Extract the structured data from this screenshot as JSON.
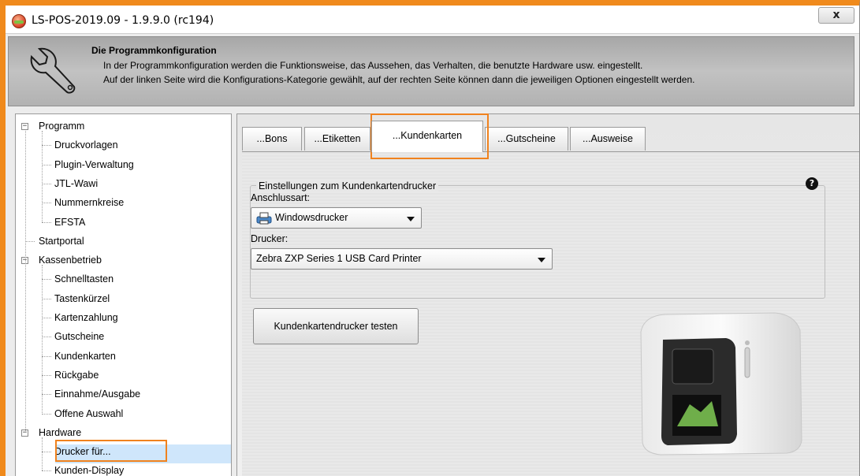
{
  "window": {
    "title": "LS-POS-2019.09 - 1.9.9.0 (rc194)",
    "close_label": "x",
    "accent_color": "#f0821e"
  },
  "header": {
    "title": "Die Programmkonfiguration",
    "line1": "In der Programmkonfiguration werden die Funktionsweise, das Aussehen, das Verhalten, die benutzte Hardware usw. eingestellt.",
    "line2": "Auf der linken Seite wird die Konfigurations-Kategorie gewählt, auf der rechten Seite können dann die jeweiligen Optionen eingestellt werden.",
    "icon": "wrench-icon"
  },
  "tree": {
    "items": [
      {
        "label": "Programm",
        "level": 0,
        "expanded": true
      },
      {
        "label": "Druckvorlagen",
        "level": 1
      },
      {
        "label": "Plugin-Verwaltung",
        "level": 1
      },
      {
        "label": "JTL-Wawi",
        "level": 1
      },
      {
        "label": "Nummernkreise",
        "level": 1
      },
      {
        "label": "EFSTA",
        "level": 1
      },
      {
        "label": "Startportal",
        "level": 0
      },
      {
        "label": "Kassenbetrieb",
        "level": 0,
        "expanded": true
      },
      {
        "label": "Schnelltasten",
        "level": 1
      },
      {
        "label": "Tastenkürzel",
        "level": 1
      },
      {
        "label": "Kartenzahlung",
        "level": 1
      },
      {
        "label": "Gutscheine",
        "level": 1
      },
      {
        "label": "Kundenkarten",
        "level": 1
      },
      {
        "label": "Rückgabe",
        "level": 1
      },
      {
        "label": "Einnahme/Ausgabe",
        "level": 1
      },
      {
        "label": "Offene Auswahl",
        "level": 1
      },
      {
        "label": "Hardware",
        "level": 0,
        "expanded": true
      },
      {
        "label": "Drucker für...",
        "level": 1,
        "selected": true
      },
      {
        "label": "Kunden-Display",
        "level": 1
      }
    ]
  },
  "tabs": [
    {
      "label": "...Bons",
      "active": false
    },
    {
      "label": "...Etiketten",
      "active": false
    },
    {
      "label": "...Kundenkarten",
      "active": true
    },
    {
      "label": "...Gutscheine",
      "active": false
    },
    {
      "label": "...Ausweise",
      "active": false
    }
  ],
  "settings": {
    "group_title": "Einstellungen zum Kundenkartendrucker",
    "help_icon": "?",
    "connection_label": "Anschlussart:",
    "connection_value": "Windowsdrucker",
    "printer_label": "Drucker:",
    "printer_value": "Zebra ZXP Series 1 USB Card Printer",
    "test_button": "Kundenkartendrucker testen"
  }
}
